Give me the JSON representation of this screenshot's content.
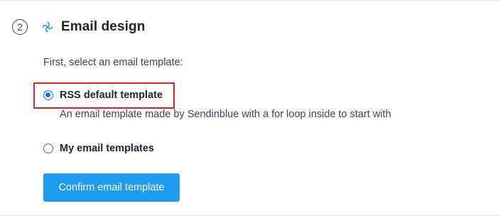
{
  "step": {
    "number": "2",
    "icon": "sendinblue-logo-icon",
    "title": "Email design"
  },
  "instruction": "First, select an email template:",
  "options": [
    {
      "label": "RSS default template",
      "description": "An email template made by Sendinblue with a for loop inside to start with",
      "selected": true,
      "highlighted": true
    },
    {
      "label": "My email templates",
      "selected": false
    }
  ],
  "confirm_button": "Confirm email template",
  "colors": {
    "accent": "#0b74e5",
    "button": "#1f9bf0",
    "highlight": "#e02424"
  }
}
